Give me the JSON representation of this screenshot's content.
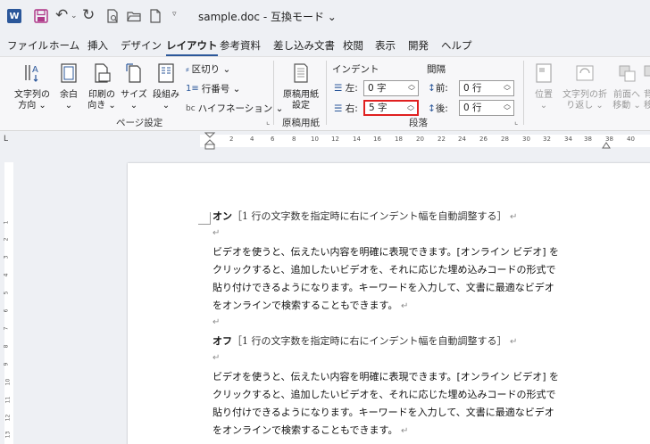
{
  "titlebar": {
    "title": "sample.doc - 互換モード",
    "dropdown_glyph": "⌄",
    "word_logo": "W",
    "undo_icon": "undo-icon",
    "redo_icon": "redo-icon"
  },
  "tabs": [
    "ファイル",
    "ホーム",
    "挿入",
    "デザイン",
    "レイアウト",
    "参考資料",
    "差し込み文書",
    "校閲",
    "表示",
    "開発",
    "ヘルプ"
  ],
  "active_tab": "レイアウト",
  "ribbon": {
    "page_setup": {
      "text_direction": [
        "文字列の",
        "方向 ⌄"
      ],
      "margins": [
        "余白",
        "⌄"
      ],
      "orientation": [
        "印刷の",
        "向き ⌄"
      ],
      "size": [
        "サイズ",
        "⌄"
      ],
      "columns": [
        "段組み",
        "⌄"
      ],
      "breaks": "区切り ⌄",
      "line_numbers": "行番号 ⌄",
      "hyphenation": "ハイフネーション ⌄",
      "label": "ページ設定"
    },
    "manuscript": {
      "button": [
        "原稿用紙",
        "設定"
      ],
      "label": "原稿用紙"
    },
    "paragraph": {
      "indent_title": "インデント",
      "spacing_title": "間隔",
      "left_label": "左:",
      "left_value": "0 字",
      "right_label": "右:",
      "right_value": "5 字",
      "before_label": "前:",
      "before_value": "0 行",
      "after_label": "後:",
      "after_value": "0 行",
      "label": "段落"
    },
    "arrange": {
      "position": [
        "位置",
        "⌄"
      ],
      "wrap": [
        "文字列の折",
        "り返し ⌄"
      ],
      "bring_forward": [
        "前面へ",
        "移動 ⌄"
      ],
      "send_backward": [
        "背",
        "移"
      ]
    }
  },
  "ruler": {
    "tab_selector": "L",
    "numbers": [
      "2",
      "4",
      "6",
      "8",
      "10",
      "12",
      "14",
      "16",
      "18",
      "20",
      "22",
      "24",
      "26",
      "28",
      "30",
      "32",
      "34",
      "38",
      "38",
      "40"
    ],
    "vnumbers": [
      "1",
      "2",
      "3",
      "4",
      "5",
      "6",
      "7",
      "8",
      "9",
      "10",
      "11",
      "12",
      "13"
    ]
  },
  "document": {
    "para_mark": "↵",
    "on_heading_bold": "オン",
    "on_heading_note": "［1 行の文字数を指定時に右にインデント幅を自動調整する］",
    "off_heading_bold": "オフ",
    "off_heading_note": "［1 行の文字数を指定時に右にインデント幅を自動調整する］",
    "body_lines": [
      "ビデオを使うと、伝えたい内容を明確に表現できます。[オンライン ビデオ] を",
      "クリックすると、追加したいビデオを、それに応じた埋め込みコードの形式で",
      "貼り付けできるようになります。キーワードを入力して、文書に最適なビデオ",
      "をオンラインで検索することもできます。"
    ],
    "body_lines_2": [
      "ビデオを使うと、伝えたい内容を明確に表現できます。[オンライン ビデオ] を",
      "クリックすると、追加したいビデオを、それに応じた埋め込みコードの形式で",
      "貼り付けできるようになります。キーワードを入力して、文書に最適なビデオ",
      "をオンラインで検索することもできます。"
    ]
  },
  "colors": {
    "accent": "#2b579a",
    "highlight_border": "#e02020",
    "ribbon_bg": "#f7f7f9"
  }
}
